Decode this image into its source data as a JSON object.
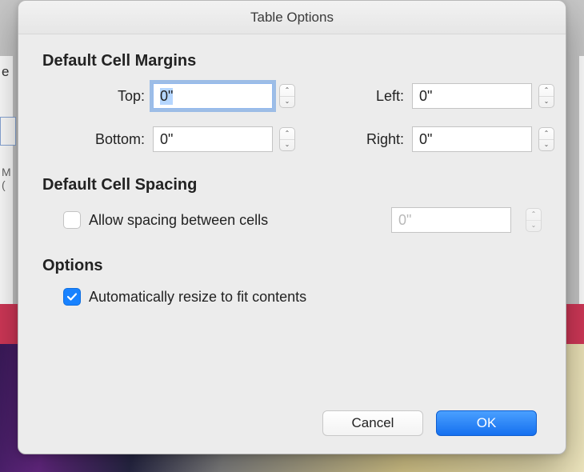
{
  "dialog": {
    "title": "Table Options"
  },
  "sections": {
    "margins": {
      "title": "Default Cell Margins",
      "top": {
        "label": "Top:",
        "value": "0\""
      },
      "bottom": {
        "label": "Bottom:",
        "value": "0\""
      },
      "left": {
        "label": "Left:",
        "value": "0\""
      },
      "right": {
        "label": "Right:",
        "value": "0\""
      }
    },
    "spacing": {
      "title": "Default Cell Spacing",
      "allow_label": "Allow spacing between cells",
      "allow_checked": false,
      "value": "0\""
    },
    "options": {
      "title": "Options",
      "autofit_label": "Automatically resize to fit contents",
      "autofit_checked": true
    }
  },
  "buttons": {
    "cancel": "Cancel",
    "ok": "OK"
  }
}
